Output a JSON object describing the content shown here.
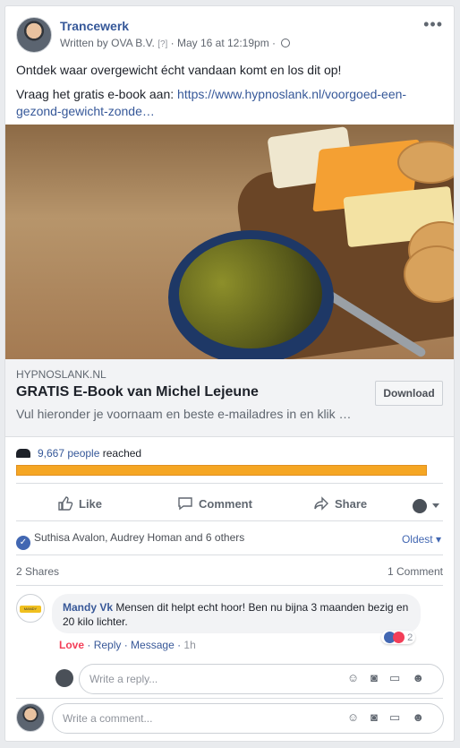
{
  "post": {
    "page_name": "Trancewerk",
    "written_by_prefix": "Written by ",
    "author": "OVA B.V.",
    "help_mark": "[?]",
    "date": " · May 16 at 12:19pm · ",
    "more_label": "•••",
    "text_line1": "Ontdek waar overgewicht écht vandaan komt en los dit op!",
    "text_line2_prefix": "Vraag het gratis e-book aan: ",
    "text_link": "https://www.hypnoslank.nl/voorgoed-een-gezond-gewicht-zonde…"
  },
  "link_preview": {
    "domain": "HYPNOSLANK.NL",
    "title": "GRATIS E-Book van Michel Lejeune",
    "description": "Vul hieronder je voornaam en beste e-mailadres in en klik …",
    "button": "Download"
  },
  "reach": {
    "count": "9,667 people",
    "suffix": " reached",
    "bar_fill": 1.0,
    "bar_color": "#f5a623"
  },
  "actions": {
    "like": "Like",
    "comment": "Comment",
    "share": "Share"
  },
  "engagement": {
    "likes_text": "Suthisa Avalon, Audrey Homan and 6 others",
    "sort_label": "Oldest ▾",
    "shares": "2 Shares",
    "comments": "1 Comment"
  },
  "comment": {
    "author": "Mandy Vk",
    "avatar_tag": "MANDY",
    "text": " Mensen dit helpt echt hoor! Ben nu bijna 3 maanden bezig en 20 kilo lichter.",
    "reaction_count": "2",
    "love": "Love",
    "reply": "Reply",
    "message": "Message",
    "time": "1h",
    "sep": " · "
  },
  "inputs": {
    "reply_placeholder": "Write a reply...",
    "comment_placeholder": "Write a comment..."
  },
  "colors": {
    "link": "#365899",
    "accent": "#4267b2",
    "love": "#f33e58"
  }
}
